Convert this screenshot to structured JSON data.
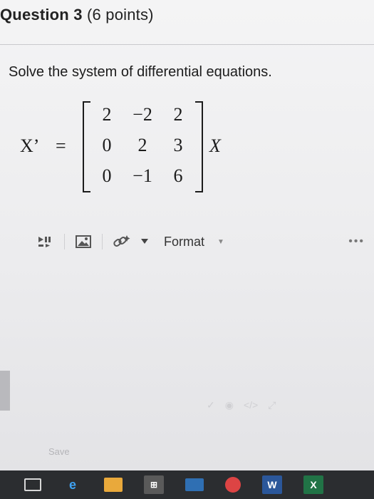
{
  "question": {
    "title": "Question 3",
    "points": "(6 points)",
    "prompt": "Solve the system of differential equations."
  },
  "equation": {
    "lhs": "X’",
    "equals": "=",
    "rhs": "X",
    "matrix": [
      [
        "2",
        "−2",
        "2"
      ],
      [
        "0",
        "2",
        "3"
      ],
      [
        "0",
        "−1",
        "6"
      ]
    ]
  },
  "toolbar": {
    "format_label": "Format",
    "more_label": "•••"
  },
  "editor": {
    "save_label": "Save"
  },
  "taskbar": {
    "edge_label": "e",
    "word_label": "W",
    "excel_label": "X"
  },
  "icons": {
    "media": "media-icon",
    "image": "image-icon",
    "link": "link-icon",
    "dropdown": "chevron-down-icon",
    "more": "more-icon"
  }
}
